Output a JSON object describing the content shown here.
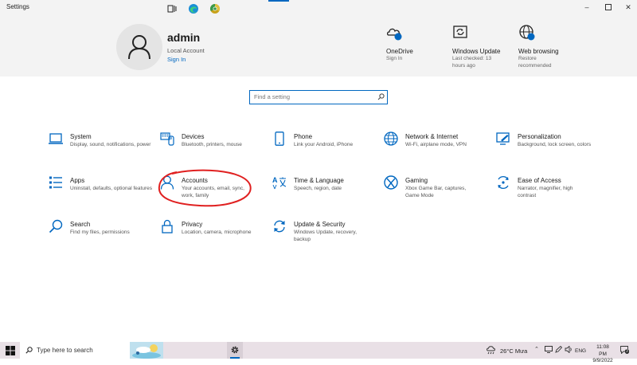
{
  "window": {
    "title": "Settings"
  },
  "account": {
    "name": "admin",
    "type": "Local Account",
    "sign_in": "Sign In"
  },
  "header_items": [
    {
      "icon": "onedrive-icon",
      "title": "OneDrive",
      "sub": "Sign In"
    },
    {
      "icon": "windows-update-icon",
      "title": "Windows Update",
      "sub": "Last checked: 13 hours ago"
    },
    {
      "icon": "web-browsing-icon",
      "title": "Web browsing",
      "sub": "Restore recommended"
    }
  ],
  "search": {
    "placeholder": "Find a setting"
  },
  "tiles": [
    {
      "icon": "laptop-icon",
      "title": "System",
      "desc": "Display, sound, notifications, power"
    },
    {
      "icon": "devices-icon",
      "title": "Devices",
      "desc": "Bluetooth, printers, mouse"
    },
    {
      "icon": "phone-icon",
      "title": "Phone",
      "desc": "Link your Android, iPhone"
    },
    {
      "icon": "globe-icon",
      "title": "Network & Internet",
      "desc": "Wi-Fi, airplane mode, VPN"
    },
    {
      "icon": "personalization-icon",
      "title": "Personalization",
      "desc": "Background, lock screen, colors"
    },
    {
      "icon": "apps-icon",
      "title": "Apps",
      "desc": "Uninstall, defaults, optional features"
    },
    {
      "icon": "person-icon",
      "title": "Accounts",
      "desc": "Your accounts, email, sync, work, family"
    },
    {
      "icon": "time-language-icon",
      "title": "Time & Language",
      "desc": "Speech, region, date"
    },
    {
      "icon": "xbox-icon",
      "title": "Gaming",
      "desc": "Xbox Game Bar, captures, Game Mode"
    },
    {
      "icon": "ease-of-access-icon",
      "title": "Ease of Access",
      "desc": "Narrator, magnifier, high contrast"
    },
    {
      "icon": "search-icon",
      "title": "Search",
      "desc": "Find my files, permissions"
    },
    {
      "icon": "lock-icon",
      "title": "Privacy",
      "desc": "Location, camera, microphone"
    },
    {
      "icon": "update-icon",
      "title": "Update & Security",
      "desc": "Windows Update, recovery, backup"
    }
  ],
  "taskbar": {
    "search_text": "Type here to search",
    "weather": "26°C Mưa",
    "lang": "ENG",
    "time": "11:08 PM",
    "date": "9/9/2022",
    "notification_count": "3"
  },
  "colors": {
    "accent": "#0067c0",
    "annotation": "#e02020",
    "header_bg": "#f3f3f3"
  }
}
